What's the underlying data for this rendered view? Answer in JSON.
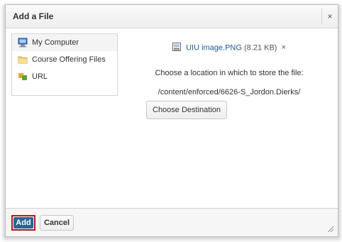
{
  "dialog": {
    "title": "Add a File",
    "close_glyph": "×"
  },
  "sidebar": {
    "items": [
      {
        "label": "My Computer",
        "icon": "computer-icon",
        "active": true
      },
      {
        "label": "Course Offering Files",
        "icon": "folder-icon",
        "active": false
      },
      {
        "label": "URL",
        "icon": "url-icon",
        "active": false
      }
    ]
  },
  "main": {
    "file_name": "UIU image.PNG",
    "file_size": "(8.21 KB)",
    "remove_glyph": "×",
    "location_prompt": "Choose a location in which to store the file:",
    "path": "/content/enforced/6626-S_Jordon.Dierks/",
    "choose_button": "Choose Destination"
  },
  "footer": {
    "add_label": "Add",
    "cancel_label": "Cancel"
  },
  "colors": {
    "primary": "#2a6496",
    "highlight_border": "#b01b1b",
    "link": "#1a5a96"
  }
}
